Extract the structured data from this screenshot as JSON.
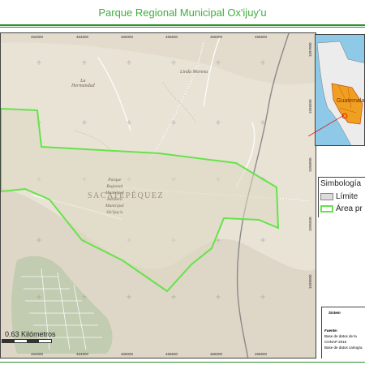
{
  "title": "Parque Regional Municipal Ox'ijuy'u",
  "colors": {
    "title": "#3fae3f",
    "park_boundary": "#66e34a",
    "basemap": "#e9e3d6",
    "park_fill": "#ddd8c2",
    "roads": "#c8c2b6",
    "highway": "#8a8a8a",
    "urban": "#9ab39a",
    "ocean": "#8ec9e8",
    "inset_region": "#f0a020"
  },
  "map": {
    "x_ticks_top": [
      "464000",
      "464500",
      "465000",
      "465500",
      "466000",
      "466500"
    ],
    "x_ticks_bottom": [
      "464000",
      "464500",
      "465000",
      "465500",
      "466000",
      "466500"
    ],
    "y_ticks_right": [
      "1597000",
      "1596500",
      "1596000",
      "1595500",
      "1595000"
    ],
    "department_label": "SACATEPÉQUEZ",
    "places": [
      {
        "name": "La\nHermandad"
      },
      {
        "name": "Linda Morena"
      },
      {
        "name": "Parque\nRegional\nMunicipal\nAstillero\nMunicipal\nOx'ijuy'u"
      }
    ],
    "scale_label": "0.63 Kilómetros"
  },
  "inset": {
    "region_label": "Guatemala",
    "regions": [
      "Sacatepéquez"
    ]
  },
  "legend": {
    "title": "Simbología",
    "items": [
      {
        "label": "Límite",
        "swatch": "#dcdcdc",
        "border": "#888888"
      },
      {
        "label": "Área pr",
        "swatch": "#ffffff",
        "border": "#66e34a"
      }
    ]
  },
  "info_box": {
    "system": "Sistem",
    "source_heading": "Fuente:",
    "lines": [
      "Base de datos de la",
      "CONAP 2016",
      "Base de datos cartogra"
    ]
  }
}
